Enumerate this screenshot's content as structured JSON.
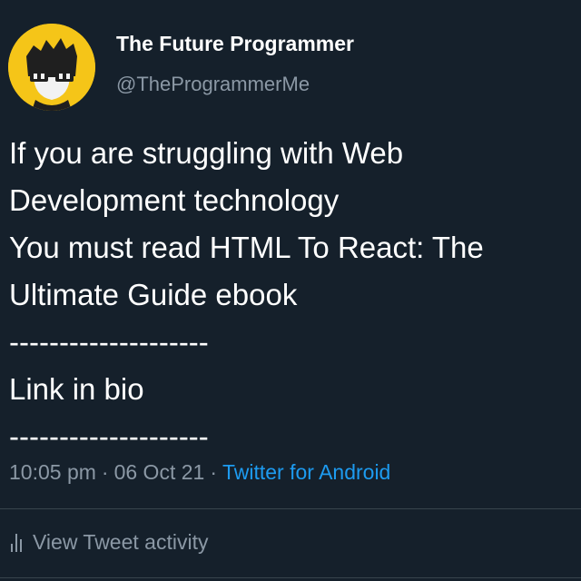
{
  "author": {
    "display_name": "The Future Programmer",
    "handle": "@TheProgrammerMe",
    "avatar_icon": "cartoon-programmer-avatar-icon"
  },
  "tweet": {
    "lines": [
      "If you are struggling with Web",
      "Development technology",
      "You must read HTML To React: The",
      "Ultimate Guide ebook",
      "--------------------",
      "Link in bio",
      "--------------------"
    ]
  },
  "meta": {
    "time": "10:05 pm",
    "separator": "·",
    "date": "06 Oct 21",
    "source": "Twitter for Android"
  },
  "activity": {
    "label": "View Tweet activity",
    "icon": "bar-chart-icon"
  },
  "colors": {
    "background": "#15202b",
    "text": "#ffffff",
    "secondary": "#8b98a5",
    "link": "#1d9bf0",
    "avatar_bg": "#f5c518"
  }
}
